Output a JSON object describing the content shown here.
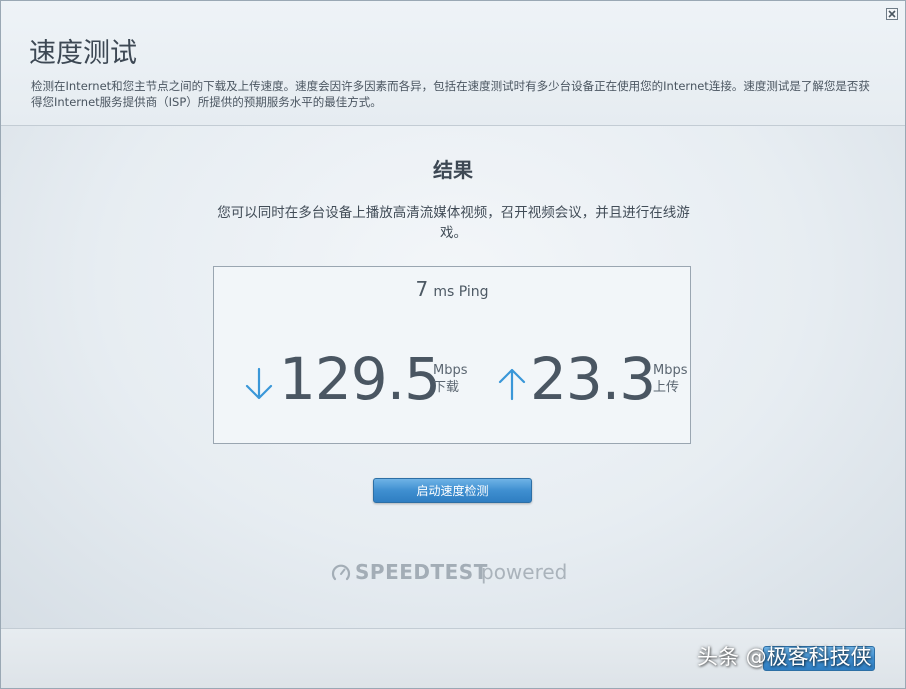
{
  "header": {
    "title": "速度测试",
    "description": "检测在Internet和您主节点之间的下载及上传速度。速度会因许多因素而各异，包括在速度测试时有多少台设备正在使用您的Internet连接。速度测试是了解您是否获得您Internet服务提供商（ISP）所提供的预期服务水平的最佳方式。"
  },
  "result": {
    "title": "结果",
    "description": "您可以同时在多台设备上播放高清流媒体视频，召开视频会议，并且进行在线游戏。",
    "ping_value": "7",
    "ping_unit": "ms Ping",
    "download": {
      "value": "129.5",
      "unit": "Mbps",
      "label": "下载",
      "icon": "arrow-down-icon"
    },
    "upload": {
      "value": "23.3",
      "unit": "Mbps",
      "label": "上传",
      "icon": "arrow-up-icon"
    }
  },
  "actions": {
    "start_label": "启动速度检测"
  },
  "logo": {
    "strong": "SPEEDTEST",
    "light": "powered",
    "icon": "speedometer-icon"
  },
  "watermark": "头条 @极客科技侠",
  "colors": {
    "accent": "#3f8fd0",
    "arrow": "#3a97d8",
    "text": "#3d4854"
  }
}
